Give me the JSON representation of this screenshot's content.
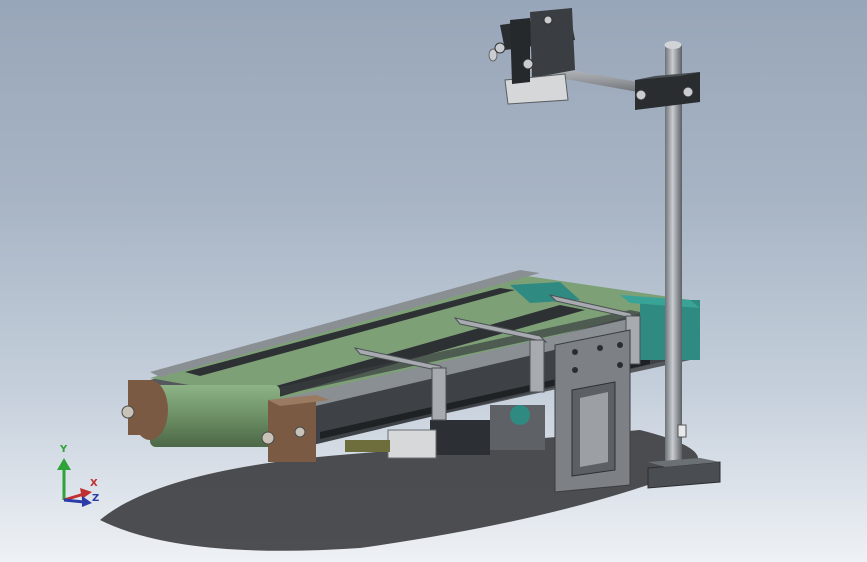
{
  "viewport": {
    "background_top": "#98a6b9",
    "background_bottom": "#eef1f5"
  },
  "model": {
    "icon": "conveyor-assembly-3d-model",
    "belt_color": "#7da077",
    "frame_color": "#6f7478",
    "end_cap_color": "#7a5a43",
    "motor_color": "#2f8a82"
  },
  "triad": {
    "y_label": "Y",
    "x_label": "X",
    "z_label": "Z",
    "y_color": "#2fa33a",
    "x_color": "#c03030",
    "z_color": "#2b3ca8"
  }
}
